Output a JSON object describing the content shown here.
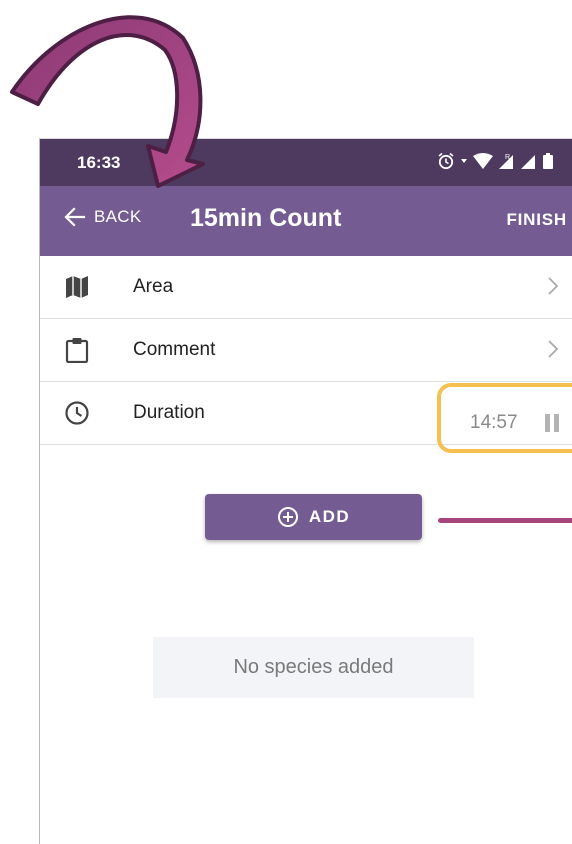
{
  "status_bar": {
    "time": "16:33",
    "icons": [
      "alarm-icon",
      "wifi-icon",
      "signal-roaming-icon",
      "signal-icon",
      "battery-icon"
    ]
  },
  "app_bar": {
    "back_label": "BACK",
    "title": "15min Count",
    "finish_label": "FINISH"
  },
  "list": {
    "area": {
      "label": "Area",
      "icon": "map-icon"
    },
    "comment": {
      "label": "Comment",
      "icon": "clipboard-icon"
    },
    "duration": {
      "label": "Duration",
      "icon": "clock-icon",
      "value": "14:57"
    }
  },
  "add_button": {
    "label": "ADD"
  },
  "empty_state": {
    "text": "No species added"
  },
  "colors": {
    "app_bar": "#745b92",
    "status_bar": "#4d3a5e",
    "annotation_arrow": "#a8457c",
    "highlight_box": "#f5c04f"
  }
}
